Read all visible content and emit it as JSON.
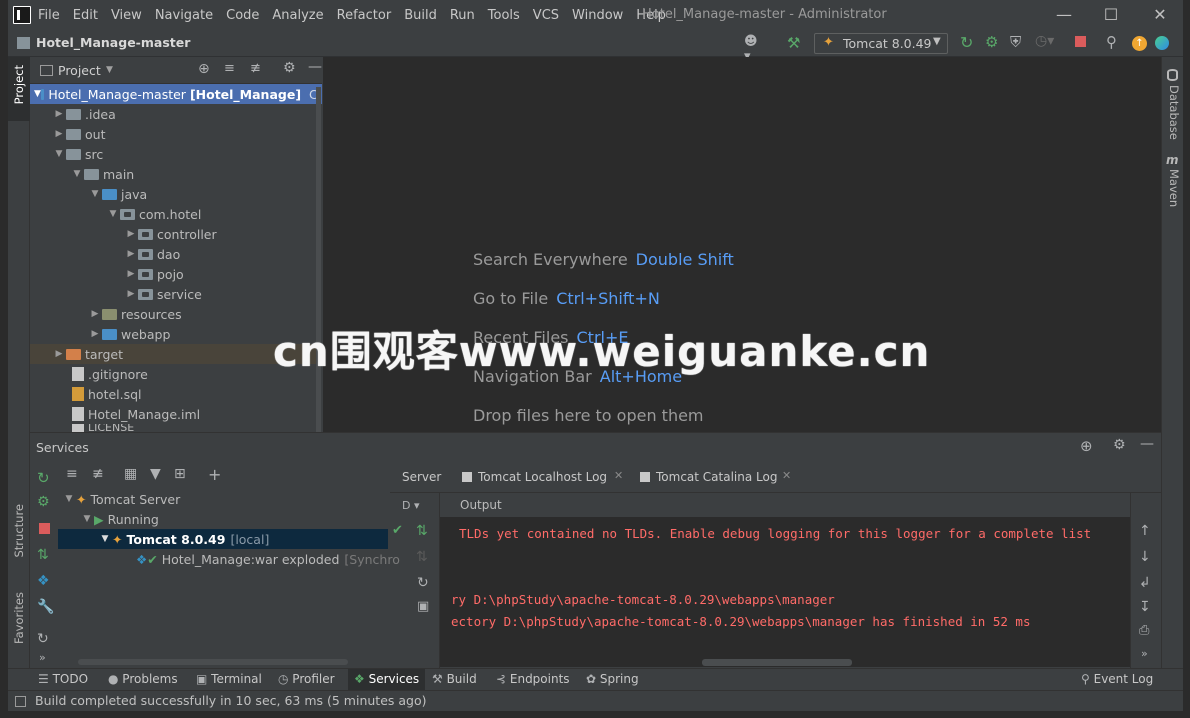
{
  "menu": [
    "File",
    "Edit",
    "View",
    "Navigate",
    "Code",
    "Analyze",
    "Refactor",
    "Build",
    "Run",
    "Tools",
    "VCS",
    "Window",
    "Help"
  ],
  "window_title": "Hotel_Manage-master - Administrator",
  "breadcrumb": "Hotel_Manage-master",
  "run_config": "Tomcat 8.0.49",
  "left_strip": {
    "project": "Project",
    "structure": "Structure",
    "favorites": "Favorites"
  },
  "right_strip": {
    "database": "Database",
    "maven": "Maven"
  },
  "project_panel": {
    "title": "Project",
    "tree": [
      {
        "label": "Hotel_Manage-master",
        "bold": "[Hotel_Manage]",
        "suffix": "C:"
      },
      {
        "label": ".idea"
      },
      {
        "label": "out"
      },
      {
        "label": "src"
      },
      {
        "label": "main"
      },
      {
        "label": "java"
      },
      {
        "label": "com.hotel"
      },
      {
        "label": "controller"
      },
      {
        "label": "dao"
      },
      {
        "label": "pojo"
      },
      {
        "label": "service"
      },
      {
        "label": "resources"
      },
      {
        "label": "webapp"
      },
      {
        "label": "target"
      },
      {
        "label": ".gitignore"
      },
      {
        "label": "hotel.sql"
      },
      {
        "label": "Hotel_Manage.iml"
      },
      {
        "label": "LICENSE"
      }
    ]
  },
  "editor_hints": [
    {
      "label": "Search Everywhere",
      "key": "Double Shift"
    },
    {
      "label": "Go to File",
      "key": "Ctrl+Shift+N"
    },
    {
      "label": "Recent Files",
      "key": "Ctrl+E"
    },
    {
      "label": "Navigation Bar",
      "key": "Alt+Home"
    },
    {
      "label": "Drop files here to open them",
      "key": ""
    }
  ],
  "watermark": "cn围观客www.weiguanke.cn",
  "services": {
    "title": "Services",
    "tree": [
      {
        "label": "Tomcat Server"
      },
      {
        "label": "Running"
      },
      {
        "label": "Tomcat 8.0.49",
        "extra": "[local]"
      },
      {
        "label": "Hotel_Manage:war exploded",
        "extra": "[Synchro"
      }
    ],
    "tabs": [
      "Server",
      "Tomcat Localhost Log",
      "Tomcat Catalina Log"
    ],
    "output_label": "Output",
    "console": [
      " TLDs yet contained no TLDs. Enable debug logging for this logger for a complete list",
      "",
      "",
      "ry D:\\phpStudy\\apache-tomcat-8.0.29\\webapps\\manager",
      "ectory D:\\phpStudy\\apache-tomcat-8.0.29\\webapps\\manager has finished in 52 ms"
    ]
  },
  "bottom_tabs": [
    "TODO",
    "Problems",
    "Terminal",
    "Profiler",
    "Services",
    "Build",
    "Endpoints",
    "Spring"
  ],
  "event_log": "Event Log",
  "status": "Build completed successfully in 10 sec, 63 ms (5 minutes ago)"
}
